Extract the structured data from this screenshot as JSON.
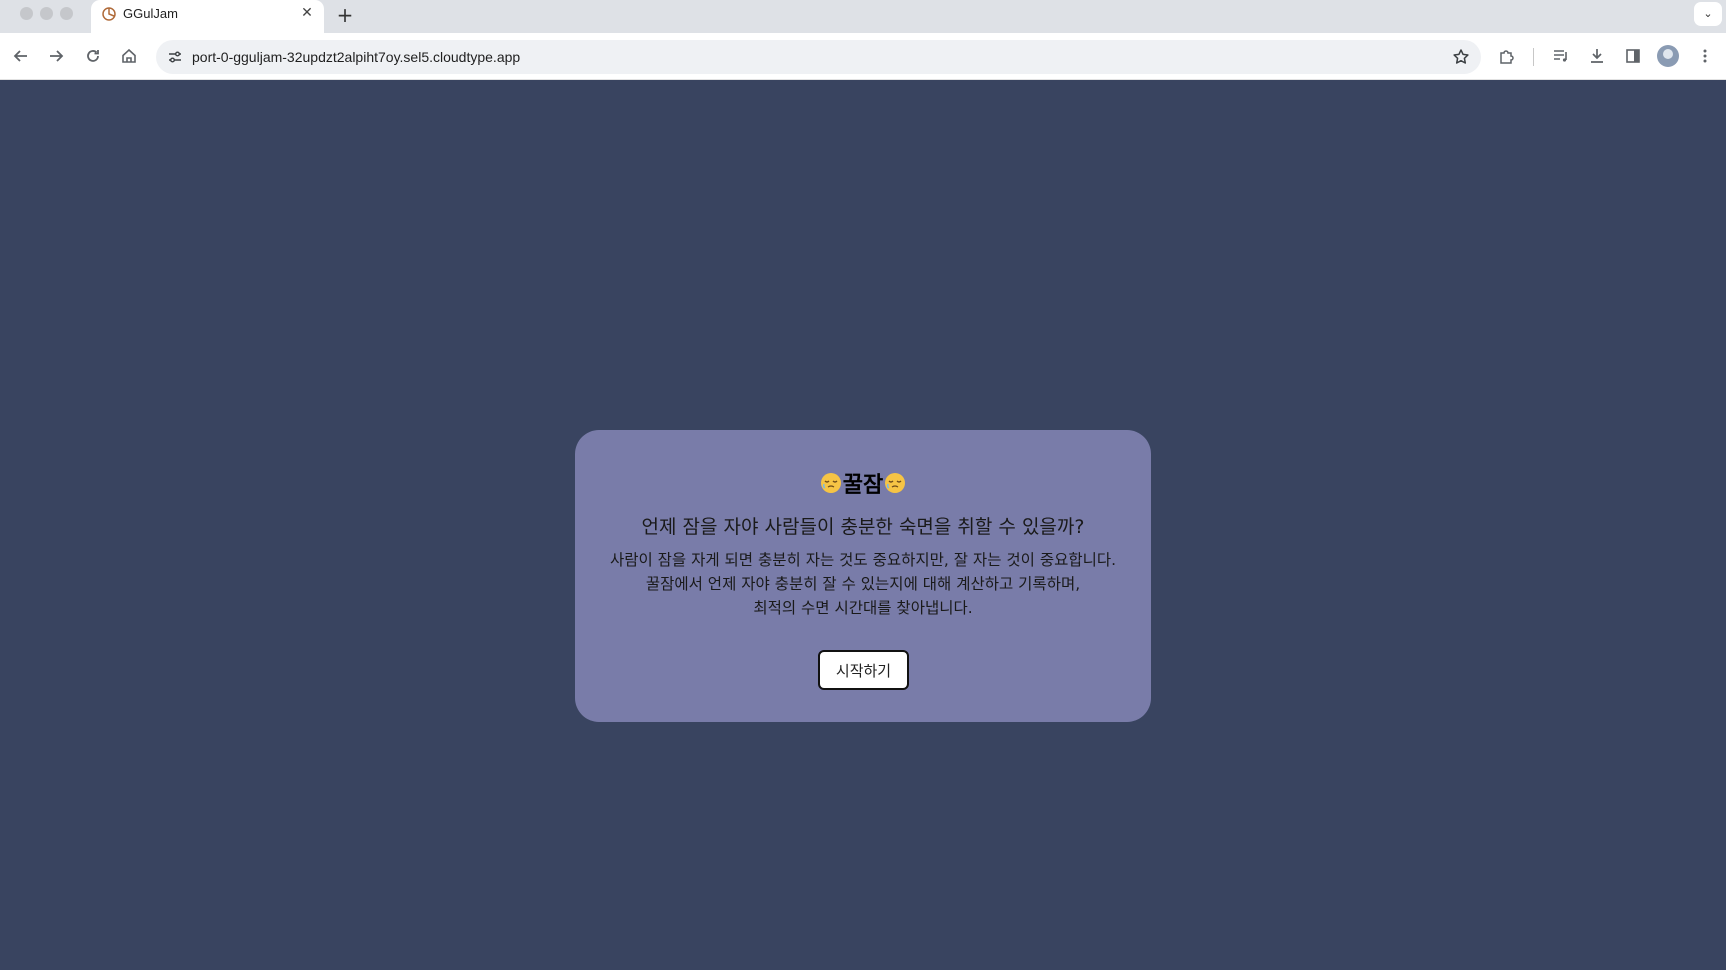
{
  "browser": {
    "tab": {
      "title": "GGulJam"
    },
    "address_bar": {
      "url": "port-0-gguljam-32updzt2alpiht7oy.sel5.cloudtype.app"
    },
    "icons": {
      "back": "arrow-left-icon",
      "forward": "arrow-right-icon",
      "reload": "reload-icon",
      "home": "home-icon",
      "site_info": "tune-icon",
      "bookmark": "star-icon",
      "extensions": "puzzle-icon",
      "media": "media-queue-icon",
      "downloads": "download-icon",
      "side_panel": "side-panel-icon",
      "profile": "avatar",
      "menu": "kebab-menu-icon"
    }
  },
  "hero": {
    "brand": "꿀잠",
    "brand_emoji": "sleepy-face",
    "headline": "언제 잠을 자야 사람들이 충분한 숙면을 취할 수 있을까?",
    "description": [
      "사람이 잠을 자게 되면 충분히 자는 것도 중요하지만, 잘 자는 것이 중요합니다.",
      "꿀잠에서 언제 자야 충분히 잘 수 있는지에 대해 계산하고 기록하며,",
      "최적의 수면 시간대를 찾아냅니다."
    ],
    "start_button": "시작하기"
  },
  "colors": {
    "page_background": "#394460",
    "card_background": "#797ca9",
    "button_background": "#ffffff"
  }
}
